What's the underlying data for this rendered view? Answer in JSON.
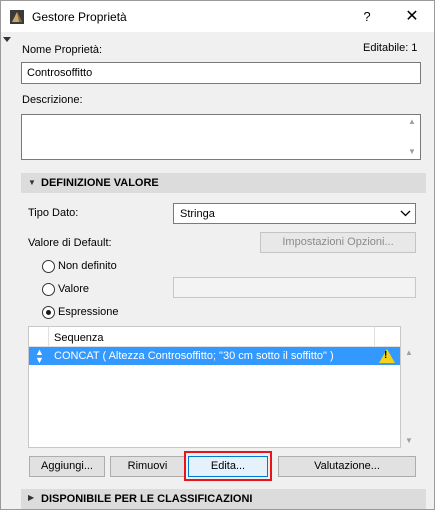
{
  "window": {
    "title": "Gestore Proprietà",
    "help_glyph": "?",
    "close_glyph": "✕"
  },
  "property": {
    "name_label": "Nome Proprietà:",
    "editable_text": "Editabile: 1",
    "name_value": "Controsoffitto",
    "description_label": "Descrizione:",
    "description_value": ""
  },
  "definition_section": {
    "title": "DEFINIZIONE VALORE",
    "data_type_label": "Tipo Dato:",
    "data_type_value": "Stringa",
    "default_label": "Valore di Default:",
    "options_button": "Impostazioni Opzioni...",
    "radios": [
      {
        "label": "Non definito",
        "selected": false
      },
      {
        "label": "Valore",
        "selected": false
      },
      {
        "label": "Espressione",
        "selected": true
      }
    ],
    "value_input": ""
  },
  "sequence_list": {
    "header": "Sequenza",
    "rows": [
      {
        "text": "CONCAT ( Altezza Controsoffitto; \"30 cm sotto il soffitto\" )",
        "selected": true,
        "warning": true
      }
    ]
  },
  "buttons": {
    "add": "Aggiungi...",
    "remove": "Rimuovi",
    "edit": "Edita...",
    "evaluate": "Valutazione..."
  },
  "classification_section": {
    "title": "DISPONIBILE PER LE CLASSIFICAZIONI"
  },
  "colors": {
    "selection": "#3399ff",
    "highlight": "#e8141c",
    "warning": "#f5d31a"
  }
}
